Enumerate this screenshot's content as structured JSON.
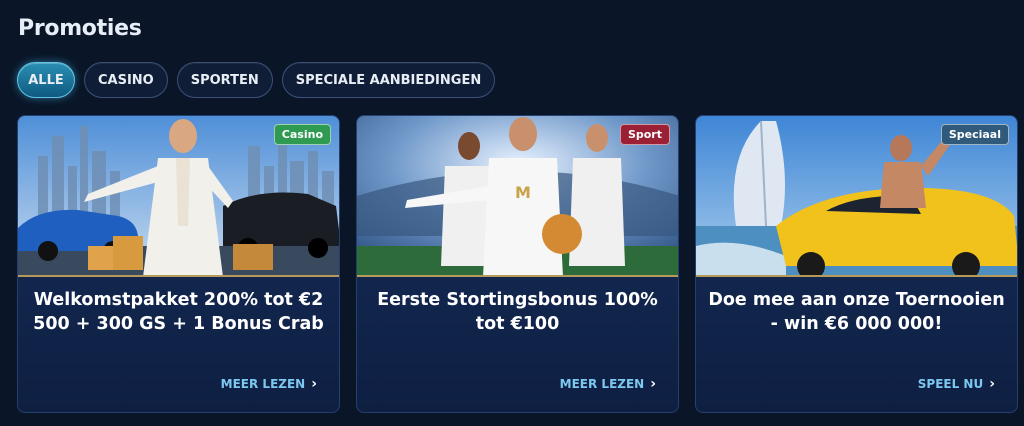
{
  "page": {
    "title": "Promoties"
  },
  "filters": [
    {
      "label": "ALLE",
      "active": true
    },
    {
      "label": "CASINO",
      "active": false
    },
    {
      "label": "SPORTEN",
      "active": false
    },
    {
      "label": "SPECIALE AANBIEDINGEN",
      "active": false
    }
  ],
  "cards": [
    {
      "badge": "Casino",
      "title": "Welkomstpakket 200% tot €2 500 + 300 GS + 1 Bonus Crab",
      "link": "MEER LEZEN",
      "badge_color": "#2e9a52"
    },
    {
      "badge": "Sport",
      "title": "Eerste Stortingsbonus 100% tot €100",
      "link": "MEER LEZEN",
      "badge_color": "#9b1f35"
    },
    {
      "badge": "Speciaal",
      "title": "Doe mee aan onze Toernooien - win €6 000 000!",
      "link": "SPEEL NU",
      "badge_color": "#2f5a7c"
    }
  ],
  "colors": {
    "background": "#0a1628",
    "active_filter": "#1a7ba6",
    "link": "#7cc8ef",
    "card": "#132750"
  },
  "icons": {
    "link_arrow": "chevron-right-icon"
  }
}
